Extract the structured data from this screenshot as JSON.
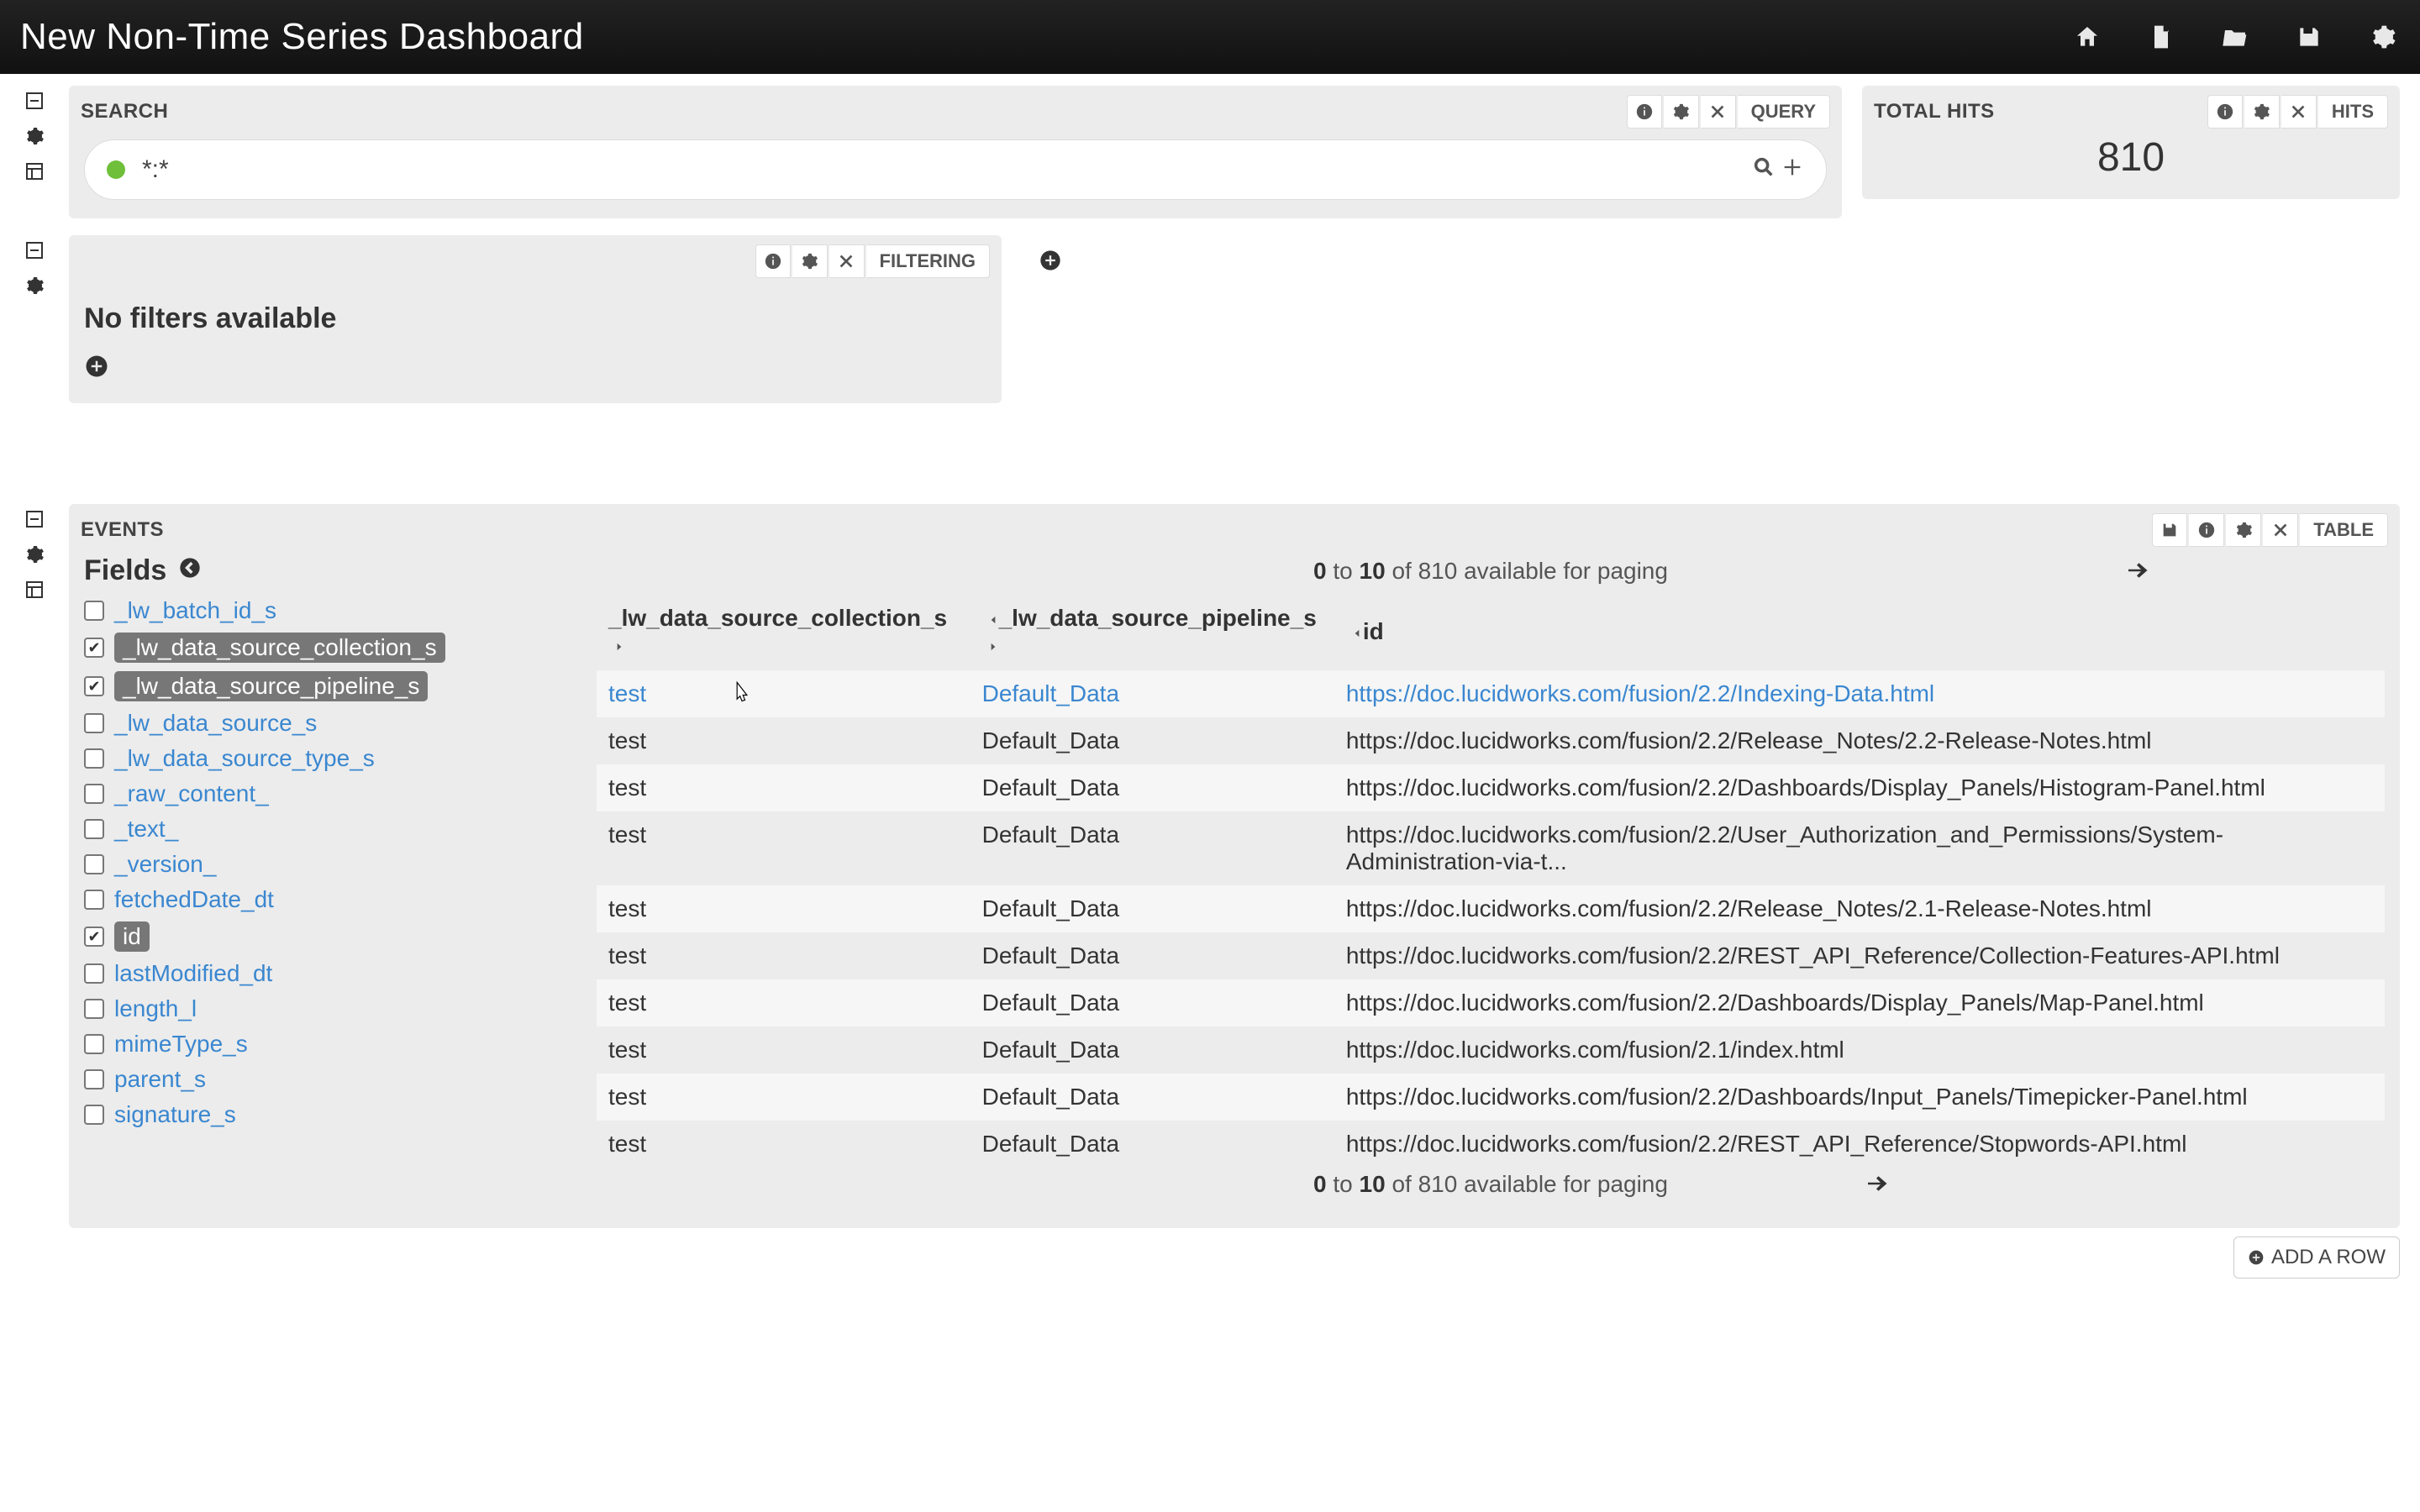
{
  "header": {
    "title": "New Non-Time Series Dashboard"
  },
  "panels": {
    "search": {
      "title": "SEARCH",
      "label": "QUERY",
      "query_value": "*:*"
    },
    "hits": {
      "title": "TOTAL HITS",
      "label": "HITS",
      "value": "810"
    },
    "filtering": {
      "label": "FILTERING",
      "no_filters": "No filters available"
    },
    "events": {
      "title": "EVENTS",
      "label": "TABLE",
      "fields_heading": "Fields",
      "fields": [
        {
          "name": "_lw_batch_id_s",
          "checked": false
        },
        {
          "name": "_lw_data_source_collection_s",
          "checked": true
        },
        {
          "name": "_lw_data_source_pipeline_s",
          "checked": true
        },
        {
          "name": "_lw_data_source_s",
          "checked": false
        },
        {
          "name": "_lw_data_source_type_s",
          "checked": false
        },
        {
          "name": "_raw_content_",
          "checked": false
        },
        {
          "name": "_text_",
          "checked": false
        },
        {
          "name": "_version_",
          "checked": false
        },
        {
          "name": "fetchedDate_dt",
          "checked": false
        },
        {
          "name": "id",
          "checked": true
        },
        {
          "name": "lastModified_dt",
          "checked": false
        },
        {
          "name": "length_l",
          "checked": false
        },
        {
          "name": "mimeType_s",
          "checked": false
        },
        {
          "name": "parent_s",
          "checked": false
        },
        {
          "name": "signature_s",
          "checked": false
        }
      ],
      "pager": {
        "from": "0",
        "to": "10",
        "total": "810",
        "suffix": "available for paging",
        "of": "of"
      },
      "columns": [
        "_lw_data_source_collection_s",
        "_lw_data_source_pipeline_s",
        "id"
      ],
      "rows": [
        {
          "c0": "test",
          "c1": "Default_Data",
          "c2": "https://doc.lucidworks.com/fusion/2.2/Indexing-Data.html",
          "hover": true
        },
        {
          "c0": "test",
          "c1": "Default_Data",
          "c2": "https://doc.lucidworks.com/fusion/2.2/Release_Notes/2.2-Release-Notes.html"
        },
        {
          "c0": "test",
          "c1": "Default_Data",
          "c2": "https://doc.lucidworks.com/fusion/2.2/Dashboards/Display_Panels/Histogram-Panel.html"
        },
        {
          "c0": "test",
          "c1": "Default_Data",
          "c2": "https://doc.lucidworks.com/fusion/2.2/User_Authorization_and_Permissions/System-Administration-via-t..."
        },
        {
          "c0": "test",
          "c1": "Default_Data",
          "c2": "https://doc.lucidworks.com/fusion/2.2/Release_Notes/2.1-Release-Notes.html"
        },
        {
          "c0": "test",
          "c1": "Default_Data",
          "c2": "https://doc.lucidworks.com/fusion/2.2/REST_API_Reference/Collection-Features-API.html"
        },
        {
          "c0": "test",
          "c1": "Default_Data",
          "c2": "https://doc.lucidworks.com/fusion/2.2/Dashboards/Display_Panels/Map-Panel.html"
        },
        {
          "c0": "test",
          "c1": "Default_Data",
          "c2": "https://doc.lucidworks.com/fusion/2.1/index.html"
        },
        {
          "c0": "test",
          "c1": "Default_Data",
          "c2": "https://doc.lucidworks.com/fusion/2.2/Dashboards/Input_Panels/Timepicker-Panel.html"
        },
        {
          "c0": "test",
          "c1": "Default_Data",
          "c2": "https://doc.lucidworks.com/fusion/2.2/REST_API_Reference/Stopwords-API.html"
        }
      ]
    }
  },
  "footer": {
    "add_row": "ADD A ROW"
  }
}
